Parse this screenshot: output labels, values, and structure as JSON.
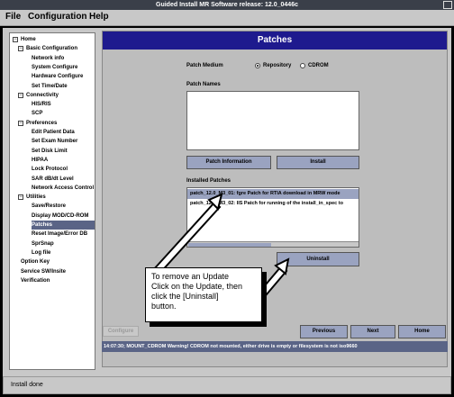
{
  "window": {
    "title": "Guided Install  MR Software release: 12.0_0446c"
  },
  "menu": {
    "file": "File",
    "configuration": "Configuration",
    "help": "Help"
  },
  "tree": {
    "items": [
      {
        "label": "Home",
        "level": 0
      },
      {
        "label": "Basic Configuration",
        "level": 1
      },
      {
        "label": "Network info",
        "level": 2
      },
      {
        "label": "System Configure",
        "level": 2
      },
      {
        "label": "Hardware Configure",
        "level": 2
      },
      {
        "label": "Set Time/Date",
        "level": 2
      },
      {
        "label": "Connectivity",
        "level": 1
      },
      {
        "label": "HIS/RIS",
        "level": 2
      },
      {
        "label": "SCP",
        "level": 2
      },
      {
        "label": "Preferences",
        "level": 1
      },
      {
        "label": "Edit Patient Data",
        "level": 2
      },
      {
        "label": "Set Exam Number",
        "level": 2
      },
      {
        "label": "Set Disk Limit",
        "level": 2
      },
      {
        "label": "HIPAA",
        "level": 2
      },
      {
        "label": "Lock Protocol",
        "level": 2
      },
      {
        "label": "SAR dB/dt Level",
        "level": 2
      },
      {
        "label": "Network Access Control",
        "level": 2
      },
      {
        "label": "Utilities",
        "level": 1
      },
      {
        "label": "Save/Restore",
        "level": 2
      },
      {
        "label": "Display MOD/CD-ROM",
        "level": 2
      },
      {
        "label": "Patches",
        "level": 2,
        "selected": true
      },
      {
        "label": "Reset Image/Error DB",
        "level": 2
      },
      {
        "label": "SprSnap",
        "level": 2
      },
      {
        "label": "Log file",
        "level": 2
      },
      {
        "label": "Option Key",
        "level": 0
      },
      {
        "label": "Service SW/Insite",
        "level": 0
      },
      {
        "label": "Verification",
        "level": 0
      }
    ]
  },
  "main": {
    "title": "Patches",
    "patch_medium_label": "Patch Medium",
    "radio_repository": "Repository",
    "radio_cdrom": "CDROM",
    "patch_names_label": "Patch Names",
    "btn_patch_information": "Patch Information",
    "btn_install": "Install",
    "installed_patches_label": "Installed Patches",
    "installed": [
      {
        "text": "patch_12.0_M3_01: fgre Patch for RTIA download in MRW mode",
        "selected": true
      },
      {
        "text": "patch_12.0_M3_02: IIS Patch for running of the install_in_spec to",
        "selected": false
      }
    ],
    "btn_uninstall": "Uninstall",
    "btn_configure": "Configure",
    "btn_previous": "Previous",
    "btn_next": "Next",
    "btn_home": "Home",
    "message": "14:07:30; MOUNT_CDROM  Warning!  CDROM not mounted, either drive is empty or filesystem is not iso9660"
  },
  "callout": {
    "line1": "To remove an Update",
    "line2": "Click on the Update, then",
    "line3": "click the [Uninstall]",
    "line4": "button."
  },
  "status": {
    "text": "Install done"
  }
}
